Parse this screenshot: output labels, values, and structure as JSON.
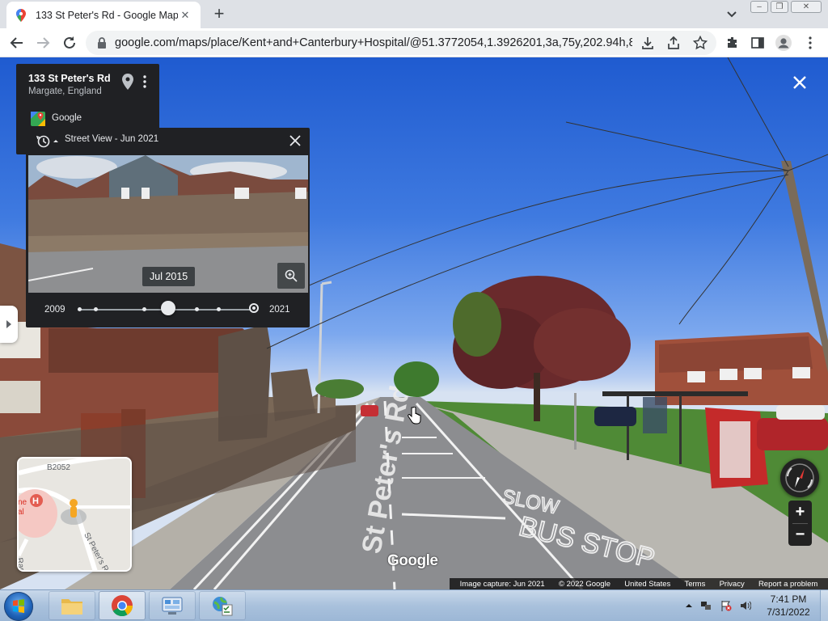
{
  "browser": {
    "tab_title": "133 St Peter's Rd - Google Maps",
    "tab_close": "✕",
    "new_tab": "+",
    "url": "google.com/maps/place/Kent+and+Canterbury+Hospital/@51.3772054,1.3926201,3a,75y,202.94h,86...."
  },
  "info_card": {
    "title": "133 St Peter's Rd",
    "subtitle": "Margate, England",
    "provider": "Google"
  },
  "time_machine": {
    "title": "Street View - Jun 2021",
    "thumb_date": "Jul 2015",
    "year_start": "2009",
    "year_end": "2021",
    "selected_fraction": 0.52
  },
  "streetview": {
    "road_marking": "St Peter's Rd",
    "road_text_slow": "SLOW",
    "road_text_bus": "BUS STOP",
    "watermark": "Google"
  },
  "minimap": {
    "road_label": "B2052",
    "street_label": "St Peter's Rd",
    "partial_label_1": "ne",
    "partial_label_2": "al",
    "partial_label_3": "Ram"
  },
  "controls": {
    "zoom_in": "+",
    "zoom_out": "−"
  },
  "footer": {
    "capture": "Image capture: Jun 2021",
    "copyright": "© 2022 Google",
    "region": "United States",
    "terms": "Terms",
    "privacy": "Privacy",
    "report": "Report a problem"
  },
  "taskbar": {
    "time": "7:41 PM",
    "date": "7/31/2022"
  },
  "colors": {
    "panel_bg": "#202124",
    "sky": "#3f7ae0",
    "taskbar": "#a9c1dc"
  }
}
